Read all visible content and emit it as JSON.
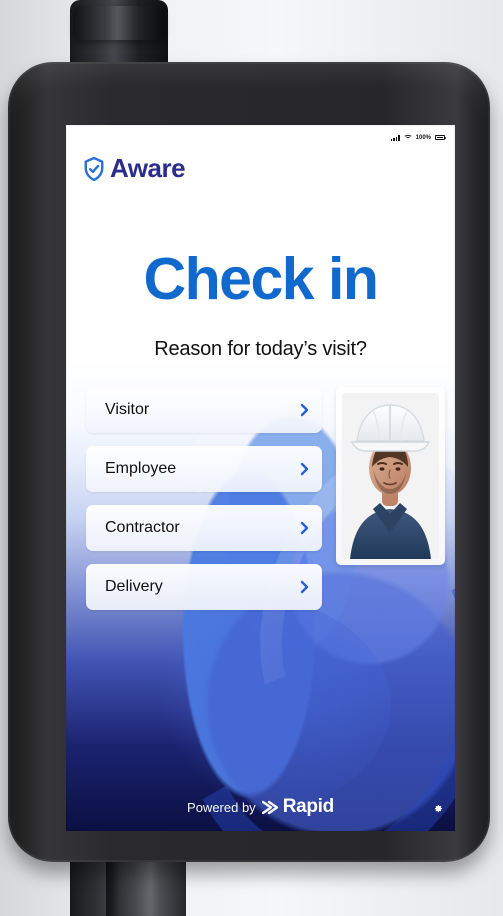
{
  "app": {
    "brand": "Aware",
    "title": "Check in",
    "prompt": "Reason for today’s visit?"
  },
  "status_bar": {
    "battery": "100%"
  },
  "options": [
    {
      "label": "Visitor",
      "icon": "chevron-right-icon"
    },
    {
      "label": "Employee",
      "icon": "chevron-right-icon"
    },
    {
      "label": "Contractor",
      "icon": "chevron-right-icon"
    },
    {
      "label": "Delivery",
      "icon": "chevron-right-icon"
    }
  ],
  "footer": {
    "powered_by": "Powered by",
    "brand": "Rapid"
  },
  "icons": {
    "brand": "shield-check-icon",
    "settings": "gear-icon",
    "signal": "signal-icon",
    "wifi": "wifi-icon",
    "battery": "battery-icon",
    "rapid": "rapid-logo-icon"
  },
  "colors": {
    "brand_navy": "#2a2d8c",
    "title_blue": "#1169ce",
    "button_chevron": "#2562d7"
  }
}
